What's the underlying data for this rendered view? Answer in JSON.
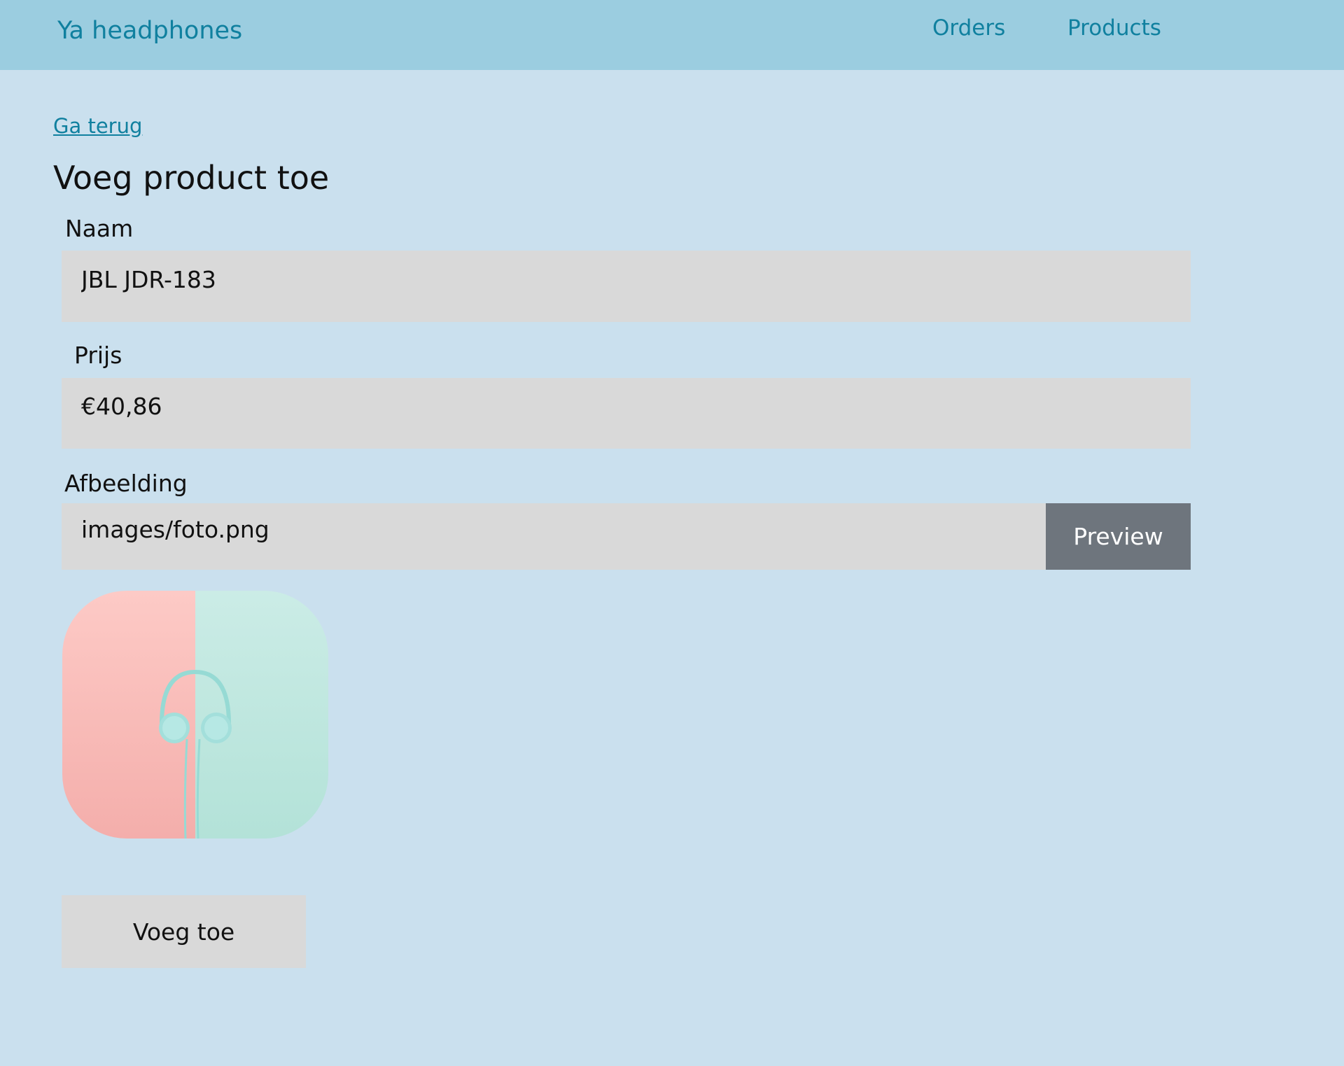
{
  "navbar": {
    "brand": "Ya headphones",
    "links": [
      {
        "label": "Orders"
      },
      {
        "label": "Products"
      }
    ]
  },
  "back_link": "Ga terug",
  "page_title": "Voeg product toe",
  "form": {
    "name": {
      "label": "Naam",
      "value": "JBL JDR-183"
    },
    "price": {
      "label": "Prijs",
      "value": "€40,86"
    },
    "image": {
      "label": "Afbeelding",
      "value": "images/foto.png"
    },
    "preview_button": "Preview",
    "submit_button": "Voeg toe"
  },
  "colors": {
    "background": "#cae0ee",
    "navbar": "#9bcde0",
    "link": "#10809f",
    "input_bg": "#d9d9d9",
    "preview_button_bg": "#6e757d"
  }
}
